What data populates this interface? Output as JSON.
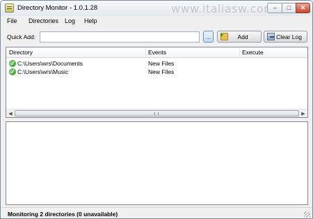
{
  "window": {
    "title": "Directory Monitor - 1.0.1.28",
    "watermark": "www.italiasw.com",
    "controls": {
      "minimize": "–",
      "maximize": "□",
      "close": "✕"
    }
  },
  "menu": {
    "items": [
      "File",
      "Directories",
      "Log",
      "Help"
    ]
  },
  "quick_add": {
    "label": "Quick Add:",
    "value": "",
    "browse_label": "...",
    "add_label": "Add",
    "clear_log_label": "Clear Log"
  },
  "directories": {
    "columns": [
      "Directory",
      "Events",
      "Execute"
    ],
    "rows": [
      {
        "directory": "C:\\Users\\wrs\\Documents",
        "events": "New Files",
        "execute": "",
        "status_icon": "check-icon"
      },
      {
        "directory": "C:\\Users\\wrs\\Music",
        "events": "New Files",
        "execute": "",
        "status_icon": "check-icon"
      }
    ]
  },
  "status": {
    "text": "Monitoring 2 directories (0 unavailable)"
  }
}
